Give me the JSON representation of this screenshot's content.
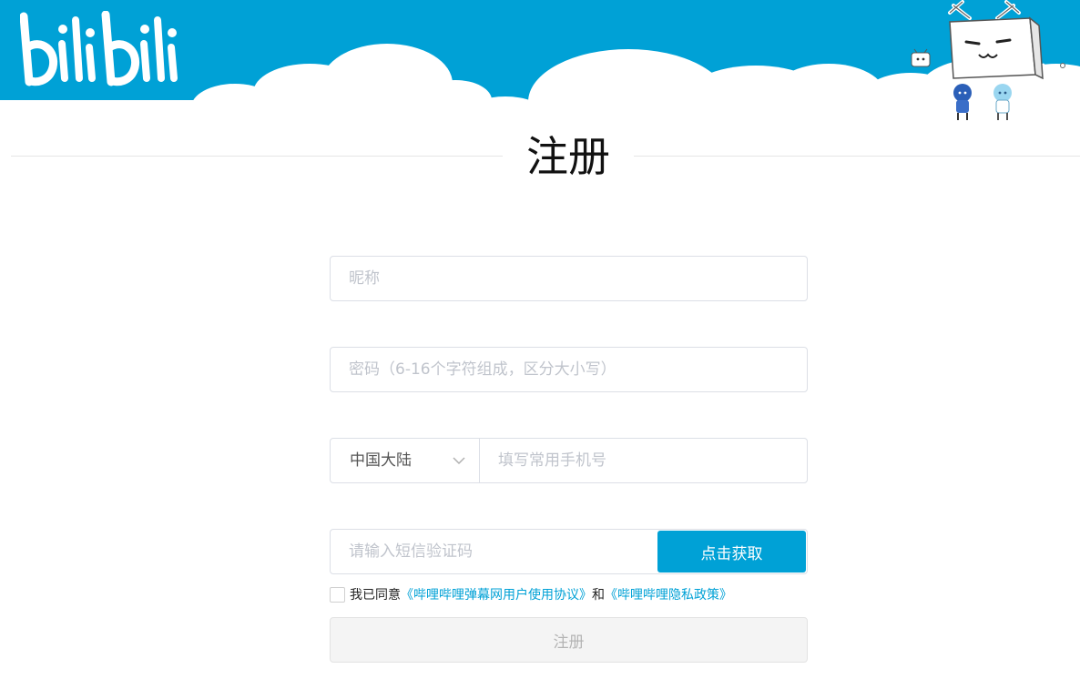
{
  "brand": {
    "logo_text": "bilibili",
    "accent_color": "#00a1d6"
  },
  "page": {
    "title": "注册"
  },
  "form": {
    "nickname": {
      "placeholder": "昵称",
      "value": ""
    },
    "password": {
      "placeholder": "密码（6-16个字符组成，区分大小写）",
      "value": ""
    },
    "phone": {
      "region": "中国大陆",
      "placeholder": "填写常用手机号",
      "value": ""
    },
    "sms": {
      "placeholder": "请输入短信验证码",
      "value": "",
      "button_label": "点击获取"
    },
    "agreement": {
      "checked": false,
      "prefix": "我已同意",
      "link_user": "《哔哩哔哩弹幕网用户使用协议》",
      "conjunction": "和",
      "link_privacy": "《哔哩哔哩隐私政策》"
    },
    "submit_label": "注册"
  },
  "icons": {
    "region_dropdown": "chevron-down-icon",
    "mascot": "tv-mascot-icon"
  }
}
